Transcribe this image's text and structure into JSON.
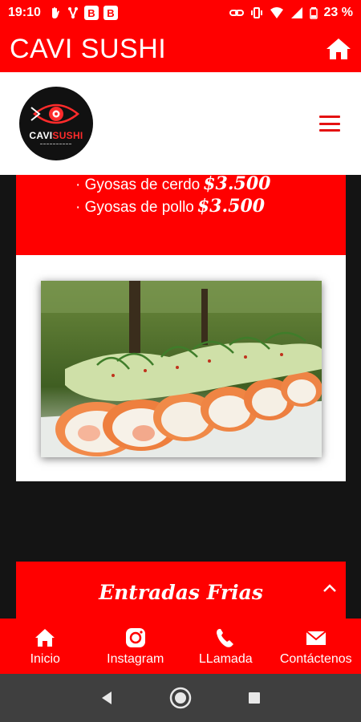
{
  "status_bar": {
    "time": "19:10",
    "badges": [
      "B",
      "B"
    ],
    "battery": "23 %"
  },
  "app_bar": {
    "title": "CAVI SUSHI",
    "home_icon": "home-icon"
  },
  "site_header": {
    "logo_text_part1": "CAVI",
    "logo_text_part2": "SUSHI",
    "menu_icon": "hamburger-menu-icon"
  },
  "menu": {
    "items": [
      {
        "name": "· Gyosas de cerdo",
        "price": "$3.500"
      },
      {
        "name": "· Gyosas de pollo",
        "price": "$3.500"
      }
    ],
    "photo_alt": "sushi-roll-photo"
  },
  "section": {
    "title": "Entradas Frias",
    "toggle_icon": "chevron-up-icon"
  },
  "bottom_nav": {
    "items": [
      {
        "label": "Inicio",
        "icon": "home-icon"
      },
      {
        "label": "Instagram",
        "icon": "instagram-icon"
      },
      {
        "label": "LLamada",
        "icon": "phone-icon"
      },
      {
        "label": "Contáctenos",
        "icon": "mail-icon"
      }
    ]
  },
  "system_nav": {
    "buttons": [
      "back-icon",
      "home-circle-icon",
      "recents-icon"
    ]
  },
  "colors": {
    "brand_red": "#ff0000",
    "background": "#141414",
    "system_nav": "#3f3f3f"
  }
}
